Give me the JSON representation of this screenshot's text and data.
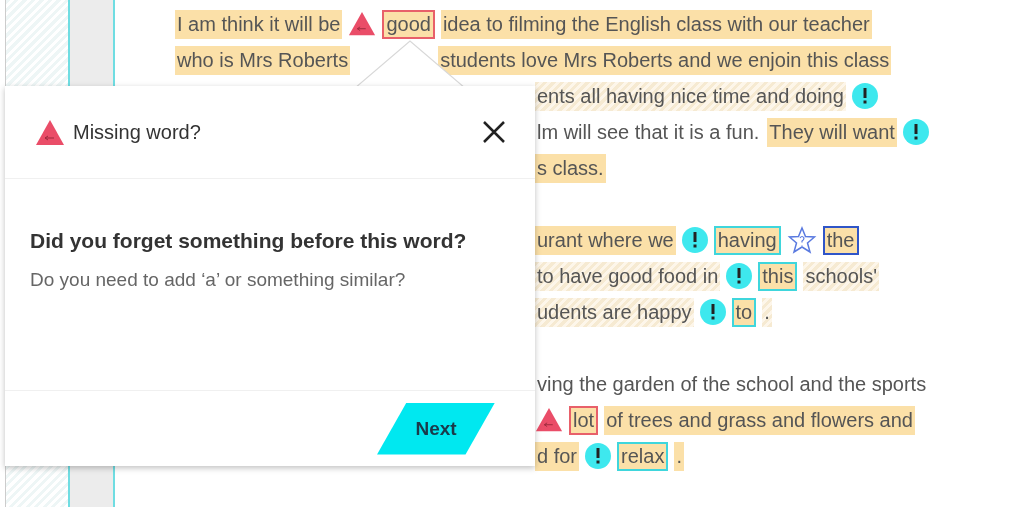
{
  "top_lines": [
    {
      "segments": [
        {
          "kind": "highlight",
          "text": "I am think it will be"
        },
        {
          "kind": "triangle"
        },
        {
          "kind": "word",
          "text": "good",
          "color": "#e8606a"
        },
        {
          "kind": "highlight",
          "text": "idea to filming the English class with our teacher"
        }
      ]
    },
    {
      "segments": [
        {
          "kind": "highlight",
          "text": "who is Mrs Roberts"
        },
        {
          "kind": "gap"
        },
        {
          "kind": "highlight",
          "text": "students love Mrs Roberts and we enjoin this class"
        }
      ]
    }
  ],
  "side_paragraphs": [
    {
      "lines": [
        {
          "segments": [
            {
              "kind": "hatched",
              "text": "ents all having nice time and doing"
            },
            {
              "kind": "alert"
            }
          ]
        },
        {
          "segments": [
            {
              "kind": "plain",
              "text": "lm will see that it is a fun."
            },
            {
              "kind": "highlight",
              "text": "They will want"
            },
            {
              "kind": "alert"
            }
          ]
        },
        {
          "segments": [
            {
              "kind": "highlight",
              "text": "s class."
            }
          ]
        }
      ]
    },
    {
      "lines": [
        {
          "segments": [
            {
              "kind": "highlight",
              "text": "urant where we"
            },
            {
              "kind": "alert"
            },
            {
              "kind": "word",
              "text": "having",
              "color": "#3fd6dc"
            },
            {
              "kind": "star"
            },
            {
              "kind": "word",
              "text": "the",
              "color": "#2f55c8"
            }
          ]
        },
        {
          "segments": [
            {
              "kind": "hatched",
              "text": "to have good food in"
            },
            {
              "kind": "alert"
            },
            {
              "kind": "word",
              "text": "this",
              "color": "#3fd6dc"
            },
            {
              "kind": "hatched",
              "text": "schools'"
            }
          ]
        },
        {
          "segments": [
            {
              "kind": "hatched",
              "text": "udents are happy"
            },
            {
              "kind": "alert"
            },
            {
              "kind": "word",
              "text": "to",
              "color": "#3fd6dc"
            },
            {
              "kind": "hatched",
              "text": "."
            }
          ]
        }
      ]
    },
    {
      "lines": [
        {
          "segments": [
            {
              "kind": "plain",
              "text": "ving the garden of the school and the sports"
            }
          ]
        },
        {
          "segments": [
            {
              "kind": "triangle"
            },
            {
              "kind": "word",
              "text": "lot",
              "color": "#e8606a"
            },
            {
              "kind": "highlight",
              "text": "of trees and grass and flowers and"
            }
          ]
        },
        {
          "segments": [
            {
              "kind": "highlight",
              "text": "d for"
            },
            {
              "kind": "alert"
            },
            {
              "kind": "word",
              "text": "relax",
              "color": "#3fd6dc"
            },
            {
              "kind": "highlight",
              "text": "."
            }
          ]
        }
      ]
    }
  ],
  "popup": {
    "title": "Missing word?",
    "question": "Did you forget something before this word?",
    "hint": "Do you need to add ‘a’ or something similar?",
    "button": "Next"
  }
}
